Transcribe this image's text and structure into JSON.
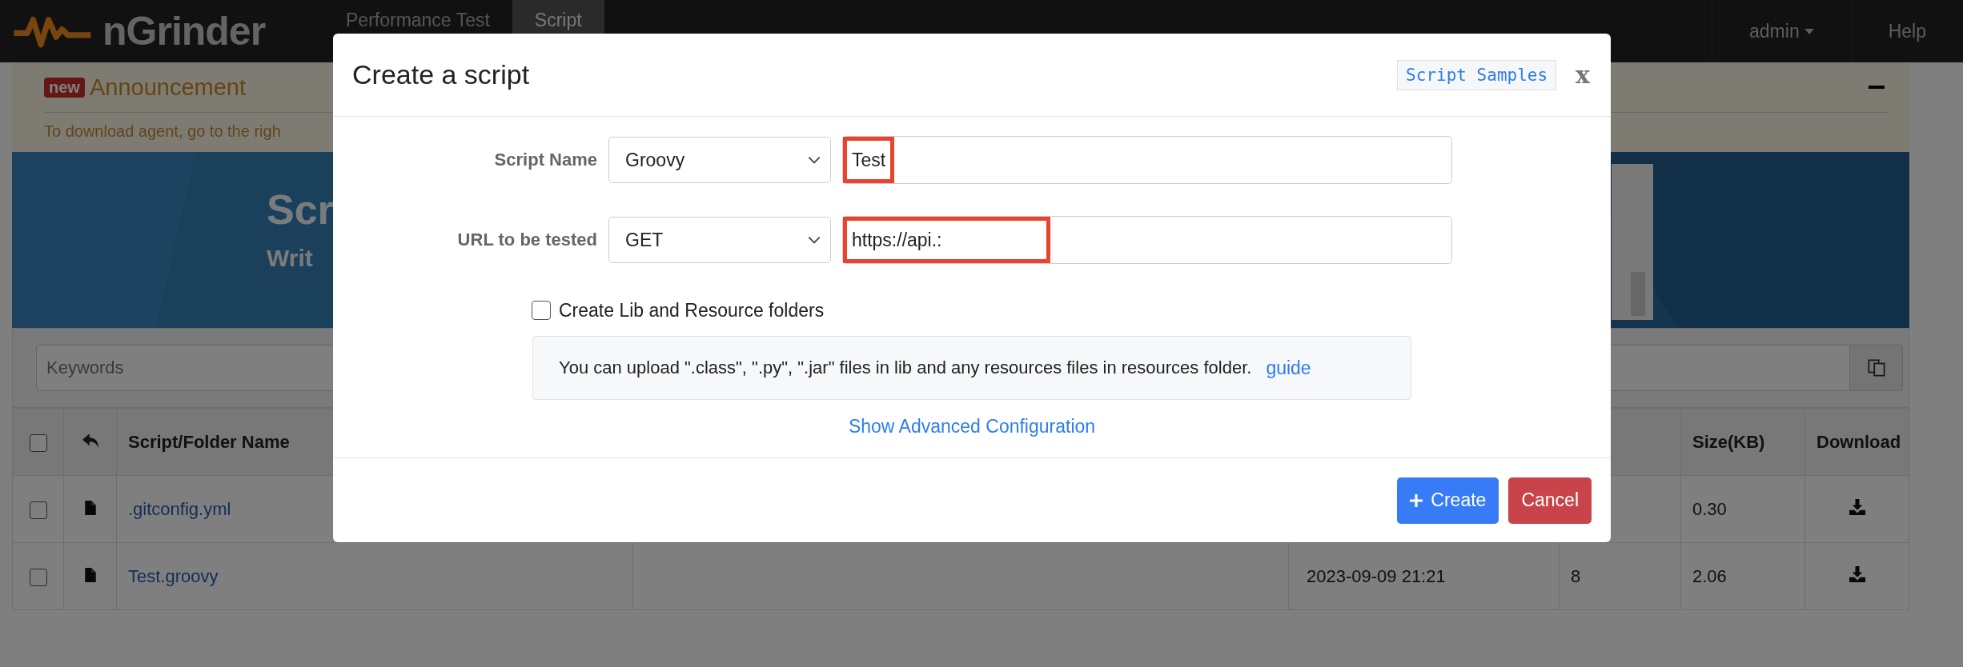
{
  "navbar": {
    "brand": "nGrinder",
    "tabs": [
      {
        "label": "Performance Test",
        "selected": false
      },
      {
        "label": "Script",
        "selected": true
      }
    ],
    "user_menu": "admin",
    "help": "Help"
  },
  "announcement": {
    "badge": "new",
    "title": "Announcement",
    "text": "To download agent, go to the righ"
  },
  "banner": {
    "title": "Scr",
    "subtitle": "Writ"
  },
  "search": {
    "placeholder": "Keywords"
  },
  "table": {
    "columns": [
      {
        "kind": "checkbox",
        "checked": false
      },
      {
        "kind": "back"
      },
      {
        "kind": "text",
        "label": "Script/Folder Name"
      },
      {
        "kind": "blank"
      },
      {
        "kind": "blank"
      },
      {
        "kind": "blank"
      },
      {
        "kind": "text",
        "label": "Size(KB)"
      },
      {
        "kind": "text",
        "label": "Download"
      }
    ],
    "rows": [
      {
        "checked": false,
        "name": ".gitconfig.yml",
        "size": "0.30"
      },
      {
        "checked": false,
        "name": "Test.groovy",
        "date": "2023-09-09 21:21",
        "revision": "8",
        "size": "2.06"
      }
    ]
  },
  "dialog": {
    "title": "Create a script",
    "samples_button": "Script Samples",
    "close": "x",
    "fields": [
      {
        "label": "Script Name",
        "select": "Groovy",
        "value": "Test",
        "highlighted": true
      },
      {
        "label": "URL to be tested",
        "select": "GET",
        "value": "https://api.:",
        "highlighted": true
      }
    ],
    "create_folders": {
      "label": "Create Lib and Resource folders",
      "checked": false
    },
    "info": {
      "text": "You can upload \".class\", \".py\", \".jar\" files in lib and any resources files in resources folder.",
      "link": "guide"
    },
    "advanced_link": "Show Advanced Configuration",
    "buttons": [
      {
        "label": "Create",
        "kind": "primary"
      },
      {
        "label": "Cancel",
        "kind": "danger"
      }
    ]
  }
}
